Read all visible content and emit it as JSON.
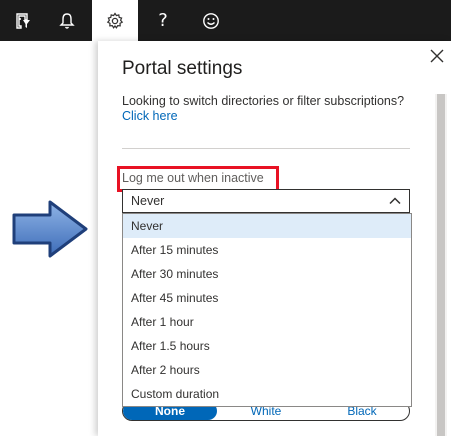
{
  "topbar": {
    "icons": [
      "filter-directory-icon",
      "bell-icon",
      "gear-icon",
      "question-icon",
      "smiley-icon"
    ],
    "help_glyph": "?"
  },
  "panel": {
    "title": "Portal settings",
    "switch_text": "Looking to switch directories or filter subscriptions?",
    "click_here": "Click here",
    "inactive_label": "Log me out when inactive",
    "selected_value": "Never",
    "options": [
      "Never",
      "After 15 minutes",
      "After 30 minutes",
      "After 45 minutes",
      "After 1 hour",
      "After 1.5 hours",
      "After 2 hours",
      "Custom duration"
    ],
    "theme_options": [
      "None",
      "White",
      "Black"
    ],
    "theme_selected": "None"
  },
  "colors": {
    "topbar": "#1b1b1b",
    "accent": "#0067b8",
    "highlight_box": "#e81123",
    "selected_option": "#deecf9",
    "arrow_fill": "#4f7fc6"
  }
}
